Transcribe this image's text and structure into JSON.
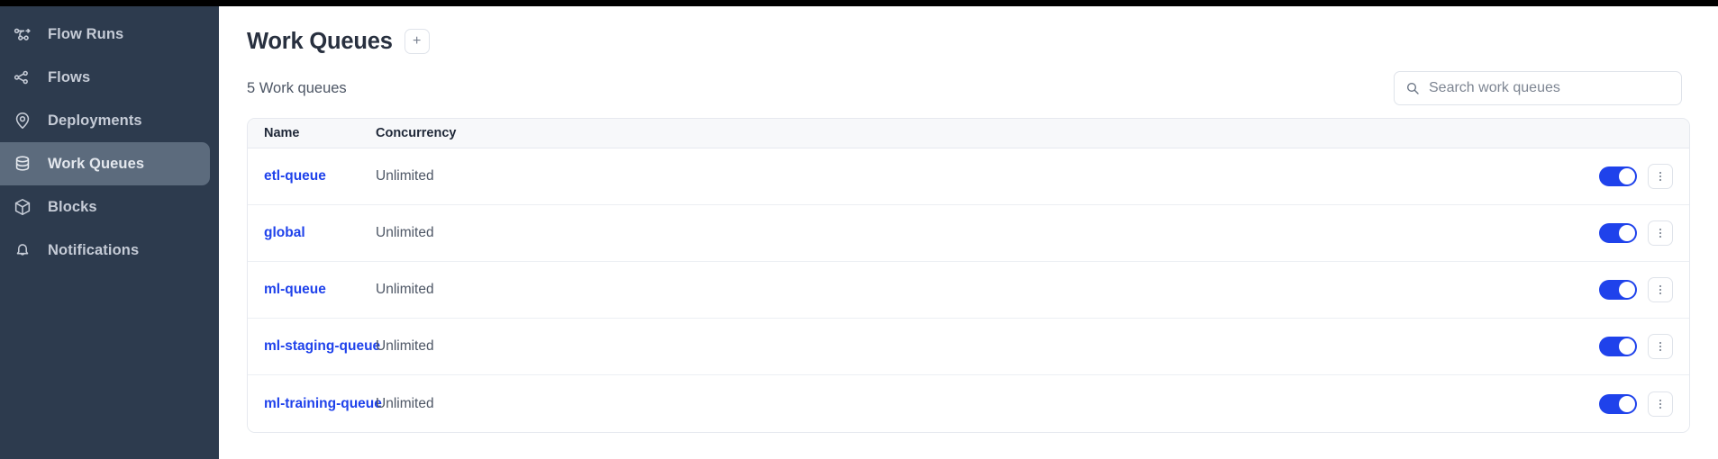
{
  "colors": {
    "sidebar_bg": "#2d3b4e",
    "sidebar_active_bg": "#5c6b7d",
    "accent_link": "#1f42eb",
    "toggle_on": "#1f42eb",
    "title_text": "#28303f",
    "muted_text": "#4d5665",
    "border": "#e6e9ef",
    "table_header_bg": "#f7f8fa",
    "topbar": "#000000"
  },
  "sidebar": {
    "items": [
      {
        "label": "Flow Runs",
        "icon": "flow-runs-icon",
        "active": false
      },
      {
        "label": "Flows",
        "icon": "flows-icon",
        "active": false
      },
      {
        "label": "Deployments",
        "icon": "deployments-icon",
        "active": false
      },
      {
        "label": "Work Queues",
        "icon": "work-queues-icon",
        "active": true
      },
      {
        "label": "Blocks",
        "icon": "blocks-icon",
        "active": false
      },
      {
        "label": "Notifications",
        "icon": "bell-icon",
        "active": false
      }
    ]
  },
  "header": {
    "title": "Work Queues",
    "add_label": "+"
  },
  "subhead": {
    "count_text": "5 Work queues"
  },
  "search": {
    "placeholder": "Search work queues",
    "value": "",
    "icon": "search-icon"
  },
  "table": {
    "columns": [
      "Name",
      "Concurrency"
    ],
    "rows": [
      {
        "name": "etl-queue",
        "concurrency": "Unlimited",
        "enabled": true,
        "menu_icon": "kebab-menu-icon"
      },
      {
        "name": "global",
        "concurrency": "Unlimited",
        "enabled": true,
        "menu_icon": "kebab-menu-icon"
      },
      {
        "name": "ml-queue",
        "concurrency": "Unlimited",
        "enabled": true,
        "menu_icon": "kebab-menu-icon"
      },
      {
        "name": "ml-staging-queue",
        "concurrency": "Unlimited",
        "enabled": true,
        "menu_icon": "kebab-menu-icon"
      },
      {
        "name": "ml-training-queue",
        "concurrency": "Unlimited",
        "enabled": true,
        "menu_icon": "kebab-menu-icon"
      }
    ]
  }
}
